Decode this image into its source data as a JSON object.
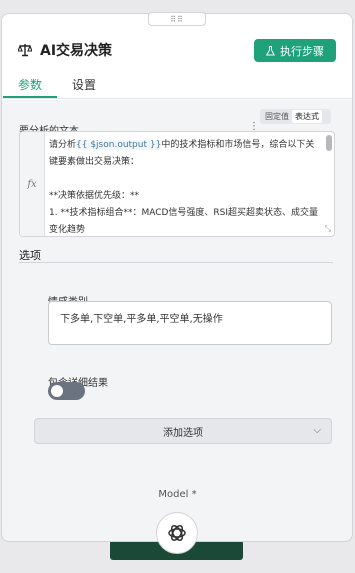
{
  "header": {
    "title": "AI交易决策",
    "execute_label": "执行步骤",
    "drag_handle": "⠿⠿"
  },
  "tabs": [
    {
      "label": "参数",
      "active": true
    },
    {
      "label": "设置",
      "active": false
    }
  ],
  "text_field": {
    "label": "要分析的文本",
    "mode_options": [
      "固定值",
      "表达式"
    ],
    "mode_selected": "表达式",
    "fx": "fx",
    "line1_prefix": "请分析",
    "line1_expr": "{{ $json.output }}",
    "line1_suffix": "中的技术指标和市场信号，综合以下关键要素做出交易决策：",
    "line2": "",
    "line3": "**决策依据优先级：**",
    "line4": "1. **技术指标组合**：MACD信号强度、RSI超买超卖状态、成交量变化趋势"
  },
  "options": {
    "section_label": "选项",
    "sentiment_label": "情感类别",
    "sentiment_value": "下多单,下空单,平多单,平空单,无操作",
    "detail_label": "包含详细结果",
    "detail_enabled": false,
    "add_option_label": "添加选项"
  },
  "model": {
    "label": "Model *"
  },
  "colors": {
    "accent": "#1fa27a",
    "toggle_off": "#6b7280"
  }
}
